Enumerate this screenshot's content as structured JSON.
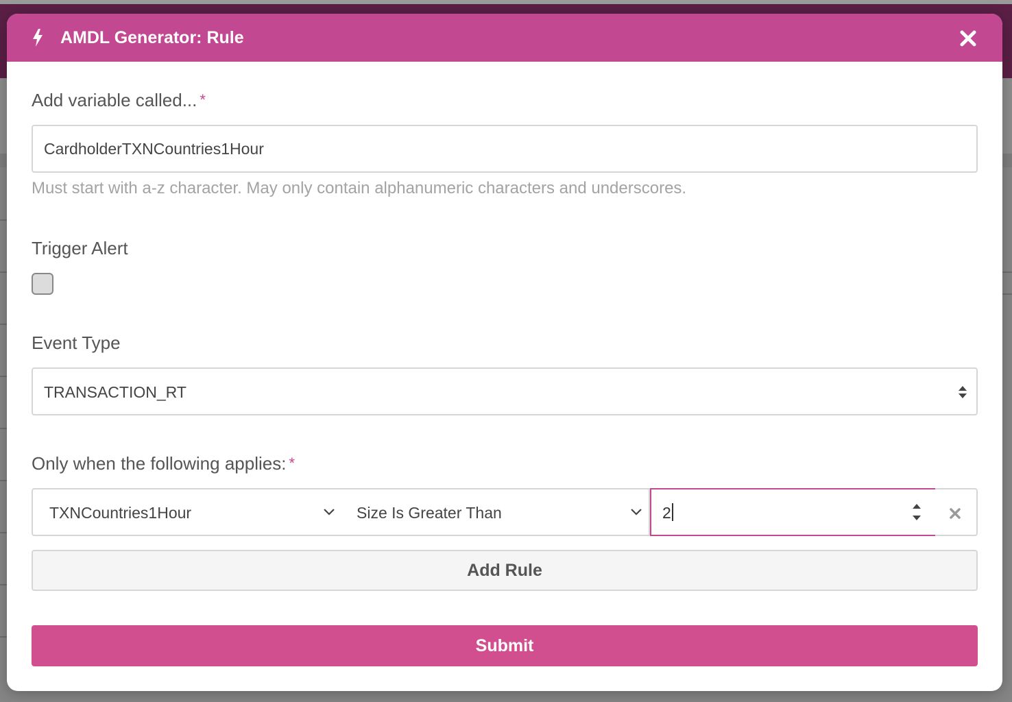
{
  "colors": {
    "accent": "#c14891",
    "submit": "#d24f8f",
    "header_bg": "#5a1f45"
  },
  "modal": {
    "title": "AMDL Generator: Rule",
    "title_icon": "bolt-icon",
    "close_icon": "close-icon"
  },
  "variable": {
    "label": "Add variable called...",
    "required_mark": "*",
    "value": "CardholderTXNCountries1Hour",
    "help": "Must start with a-z character. May only contain alphanumeric characters and underscores."
  },
  "trigger_alert": {
    "label": "Trigger Alert",
    "checked": false
  },
  "event_type": {
    "label": "Event Type",
    "selected": "TRANSACTION_RT"
  },
  "conditions": {
    "label": "Only when the following applies:",
    "required_mark": "*",
    "rules": [
      {
        "field": "TXNCountries1Hour",
        "operator": "Size Is Greater Than",
        "value": "2"
      }
    ]
  },
  "buttons": {
    "add_rule": "Add Rule",
    "submit": "Submit"
  }
}
